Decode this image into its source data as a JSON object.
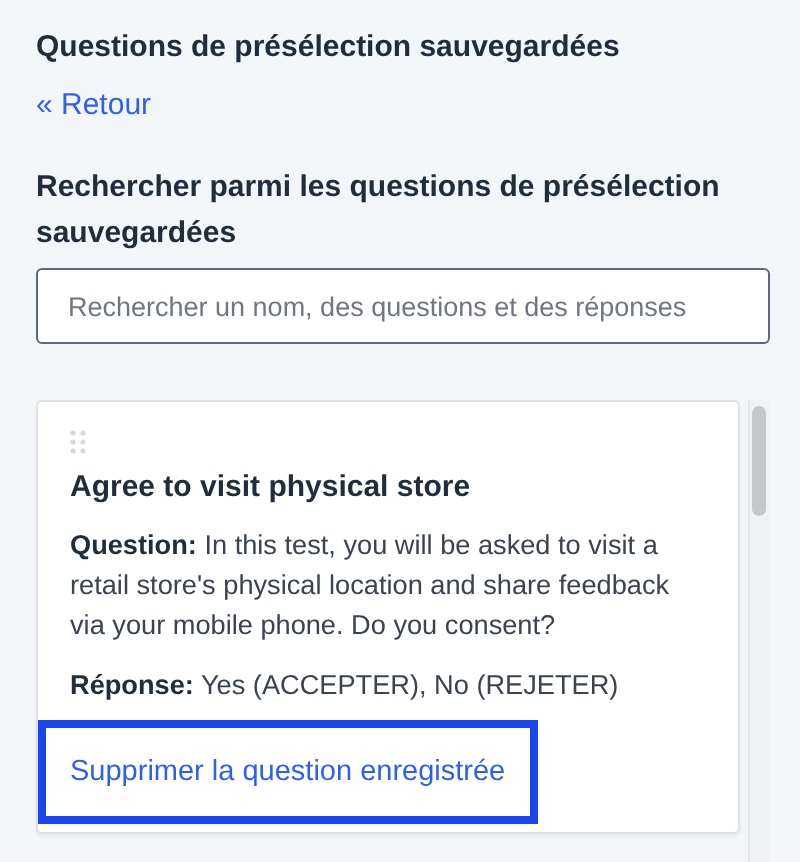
{
  "title": "Questions de présélection sauvegardées",
  "back_link": "« Retour",
  "search": {
    "label": "Rechercher parmi les questions de présélection sauvegardées",
    "placeholder": "Rechercher un nom, des questions et des réponses"
  },
  "questions": [
    {
      "name": "Agree to visit physical store",
      "question": "**Question:** In this test, you will be asked to visit a retail store's physical location and share feedback via your mobile phone. Do you consent?",
      "answer": "**Réponse:** Yes (ACCEPTER), No (REJETER)",
      "delete_link": "Supprimer la question enregistrée",
      "highlighted": true
    }
  ]
}
